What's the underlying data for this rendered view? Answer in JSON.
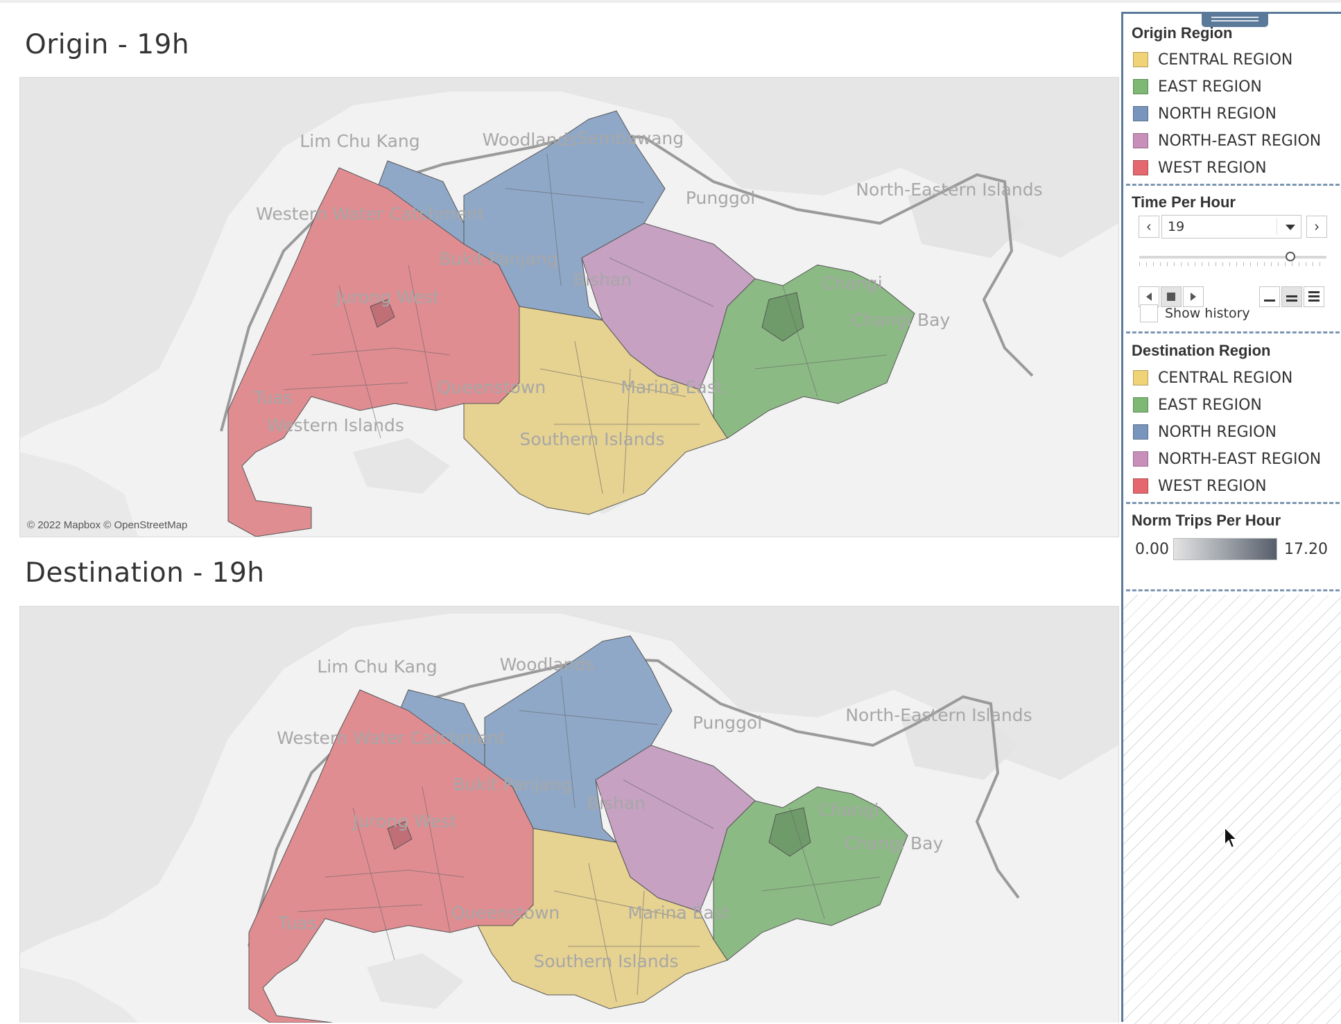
{
  "origin_map": {
    "title": "Origin - 19h",
    "attribution": "© 2022 Mapbox © OpenStreetMap",
    "place_labels": [
      "Lim Chu Kang",
      "Woodlands",
      "Sembawang",
      "Western Water Catchment",
      "Punggol",
      "North-Eastern Islands",
      "Changi",
      "Changi Bay",
      "Jurong West",
      "Bukit Panjang",
      "Tuas",
      "Western Islands",
      "Queenstown",
      "Marina East",
      "Southern Islands",
      "Bishan"
    ]
  },
  "destination_map": {
    "title": "Destination - 19h",
    "place_labels": [
      "Lim Chu Kang",
      "Woodlands",
      "Western Water Catchment",
      "Punggol",
      "North-Eastern Islands",
      "Changi",
      "Changi Bay",
      "Jurong West",
      "Bukit Panjang",
      "Tuas",
      "Queenstown",
      "Marina East",
      "Southern Islands",
      "Bishan"
    ]
  },
  "region_colors": {
    "central": "#e6d291",
    "east": "#8cba85",
    "north": "#8fa8c8",
    "north_east": "#c6a1c2",
    "west": "#e08d92"
  },
  "origin_region_legend": {
    "title": "Origin Region",
    "items": [
      {
        "label": "CENTRAL REGION",
        "color": "#f0d277"
      },
      {
        "label": "EAST REGION",
        "color": "#7db874"
      },
      {
        "label": "NORTH REGION",
        "color": "#7895bd"
      },
      {
        "label": "NORTH-EAST REGION",
        "color": "#c98fbb"
      },
      {
        "label": "WEST REGION",
        "color": "#e4686e"
      }
    ]
  },
  "time_filter": {
    "title": "Time Per Hour",
    "selected_value": "19",
    "show_history_label": "Show history",
    "show_history_checked": false
  },
  "destination_region_legend": {
    "title": "Destination Region",
    "items": [
      {
        "label": "CENTRAL REGION",
        "color": "#f0d277"
      },
      {
        "label": "EAST REGION",
        "color": "#7db874"
      },
      {
        "label": "NORTH REGION",
        "color": "#7895bd"
      },
      {
        "label": "NORTH-EAST REGION",
        "color": "#c98fbb"
      },
      {
        "label": "WEST REGION",
        "color": "#e4686e"
      }
    ]
  },
  "norm_trips_legend": {
    "title": "Norm Trips Per Hour",
    "min": "0.00",
    "max": "17.20"
  },
  "icons": [
    "chevron-left-icon",
    "chevron-right-icon",
    "dropdown-caret-icon",
    "step-back-icon",
    "stop-icon",
    "step-forward-icon",
    "speed-slow-icon",
    "speed-medium-icon",
    "speed-fast-icon",
    "cursor-icon"
  ]
}
